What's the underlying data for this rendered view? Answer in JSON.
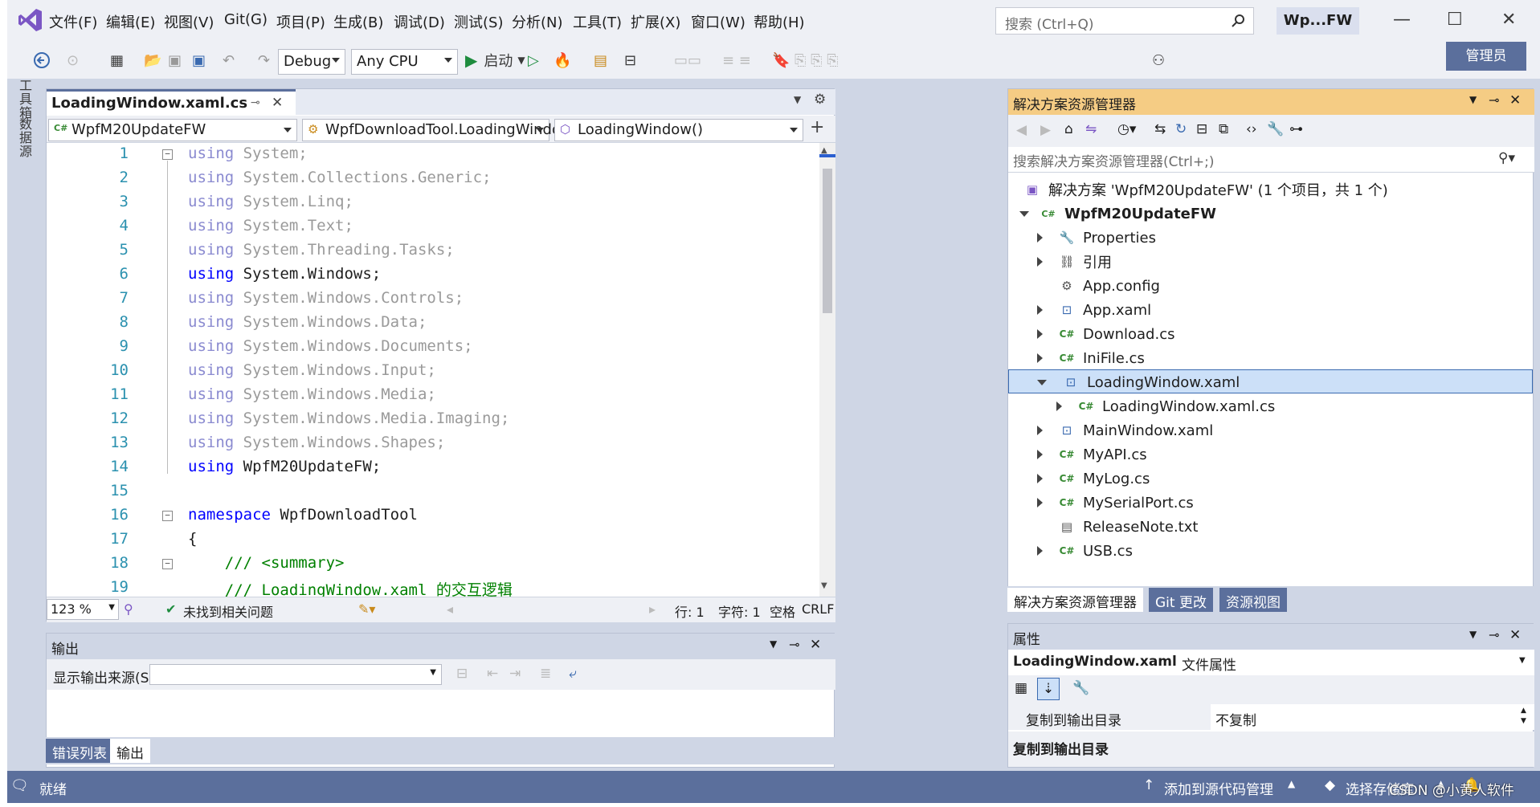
{
  "titlebar": {
    "menus": [
      "文件(F)",
      "编辑(E)",
      "视图(V)",
      "Git(G)",
      "项目(P)",
      "生成(B)",
      "调试(D)",
      "测试(S)",
      "分析(N)",
      "工具(T)",
      "扩展(X)",
      "窗口(W)",
      "帮助(H)"
    ],
    "search_placeholder": "搜索 (Ctrl+Q)",
    "window_title": "Wp...FW"
  },
  "toolbar": {
    "config": "Debug",
    "platform": "Any CPU",
    "start_label": "启动",
    "admin_label": "管理员"
  },
  "side_tabs": [
    "工具箱",
    "数据源"
  ],
  "editor": {
    "tab_title": "LoadingWindow.xaml.cs",
    "nav_project": "WpfM20UpdateFW",
    "nav_class": "WpfDownloadTool.LoadingWindow",
    "nav_member": "LoadingWindow()",
    "lines": [
      {
        "n": "1",
        "kw": "using",
        "rest": " System;",
        "dim": true
      },
      {
        "n": "2",
        "kw": "using",
        "rest": " System.Collections.Generic;",
        "dim": true
      },
      {
        "n": "3",
        "kw": "using",
        "rest": " System.Linq;",
        "dim": true
      },
      {
        "n": "4",
        "kw": "using",
        "rest": " System.Text;",
        "dim": true
      },
      {
        "n": "5",
        "kw": "using",
        "rest": " System.Threading.Tasks;",
        "dim": true
      },
      {
        "n": "6",
        "kw": "using",
        "rest": " System.Windows;",
        "dim": false
      },
      {
        "n": "7",
        "kw": "using",
        "rest": " System.Windows.Controls;",
        "dim": true
      },
      {
        "n": "8",
        "kw": "using",
        "rest": " System.Windows.Data;",
        "dim": true
      },
      {
        "n": "9",
        "kw": "using",
        "rest": " System.Windows.Documents;",
        "dim": true
      },
      {
        "n": "10",
        "kw": "using",
        "rest": " System.Windows.Input;",
        "dim": true
      },
      {
        "n": "11",
        "kw": "using",
        "rest": " System.Windows.Media;",
        "dim": true
      },
      {
        "n": "12",
        "kw": "using",
        "rest": " System.Windows.Media.Imaging;",
        "dim": true
      },
      {
        "n": "13",
        "kw": "using",
        "rest": " System.Windows.Shapes;",
        "dim": true
      },
      {
        "n": "14",
        "kw": "using",
        "rest": " WpfM20UpdateFW;",
        "dim": false
      },
      {
        "n": "15",
        "kw": "",
        "rest": "",
        "dim": false
      },
      {
        "n": "16",
        "kw": "namespace",
        "rest": " WpfDownloadTool",
        "dim": false
      },
      {
        "n": "17",
        "kw": "",
        "rest": "{",
        "dim": false
      },
      {
        "n": "18",
        "kw": "",
        "rest": "    /// <summary>",
        "dim": false,
        "comment": true
      },
      {
        "n": "19",
        "kw": "",
        "rest": "    /// LoadingWindow.xaml 的交互逻辑",
        "dim": false,
        "comment": true
      }
    ],
    "zoom": "123 %",
    "issues": "未找到相关问题",
    "row": "行: 1",
    "col": "字符: 1",
    "spacing": "空格",
    "line_ending": "CRLF"
  },
  "output": {
    "title": "输出",
    "source_label": "显示输出来源(S):",
    "tabs": [
      "错误列表",
      "输出"
    ]
  },
  "solution": {
    "title": "解决方案资源管理器",
    "search_placeholder": "搜索解决方案资源管理器(Ctrl+;)",
    "solution_label": "解决方案 'WpfM20UpdateFW' (1 个项目，共 1 个)",
    "project": "WpfM20UpdateFW",
    "items": [
      {
        "label": "Properties",
        "icon": "wrench-icon",
        "expand": "closed",
        "indent": 1
      },
      {
        "label": "引用",
        "icon": "references-icon",
        "expand": "closed",
        "indent": 1
      },
      {
        "label": "App.config",
        "icon": "config-file-icon",
        "expand": "none",
        "indent": 1
      },
      {
        "label": "App.xaml",
        "icon": "xaml-file-icon",
        "expand": "closed",
        "indent": 1
      },
      {
        "label": "Download.cs",
        "icon": "csharp-file-icon",
        "expand": "closed",
        "indent": 1
      },
      {
        "label": "IniFile.cs",
        "icon": "csharp-file-icon",
        "expand": "closed",
        "indent": 1
      },
      {
        "label": "LoadingWindow.xaml",
        "icon": "xaml-file-icon",
        "expand": "open",
        "indent": 1,
        "selected": true
      },
      {
        "label": "LoadingWindow.xaml.cs",
        "icon": "csharp-file-icon",
        "expand": "closed",
        "indent": 2
      },
      {
        "label": "MainWindow.xaml",
        "icon": "xaml-file-icon",
        "expand": "closed",
        "indent": 1
      },
      {
        "label": "MyAPI.cs",
        "icon": "csharp-file-icon",
        "expand": "closed",
        "indent": 1
      },
      {
        "label": "MyLog.cs",
        "icon": "csharp-file-icon",
        "expand": "closed",
        "indent": 1
      },
      {
        "label": "MySerialPort.cs",
        "icon": "csharp-file-icon",
        "expand": "closed",
        "indent": 1
      },
      {
        "label": "ReleaseNote.txt",
        "icon": "text-file-icon",
        "expand": "none",
        "indent": 1
      },
      {
        "label": "USB.cs",
        "icon": "csharp-file-icon",
        "expand": "closed",
        "indent": 1
      }
    ],
    "tabs": [
      "解决方案资源管理器",
      "Git 更改",
      "资源视图"
    ]
  },
  "properties": {
    "title": "属性",
    "object_name": "LoadingWindow.xaml",
    "object_type": "文件属性",
    "prop_name": "复制到输出目录",
    "prop_value": "不复制",
    "description_title": "复制到输出目录"
  },
  "statusbar": {
    "ready": "就绪",
    "add_source": "添加到源代码管理",
    "select_repo": "选择存储库",
    "watermark": "CSDN @小黄人软件"
  },
  "colors": {
    "accent": "#5b6f9c",
    "solution_header": "#f5cc84",
    "selected_row": "#cce0f8"
  }
}
